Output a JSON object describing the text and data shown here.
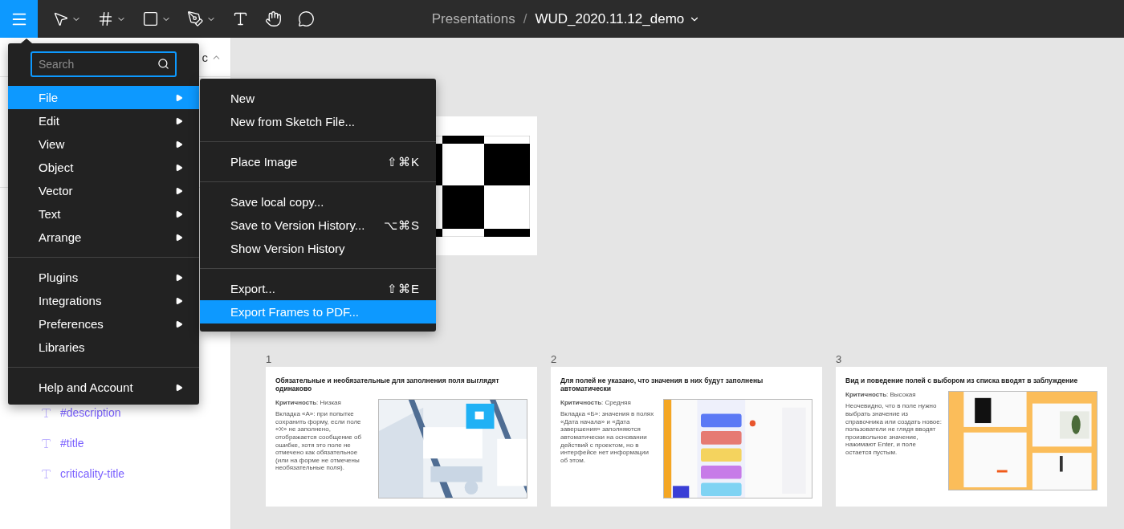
{
  "toolbar": {
    "tools": [
      {
        "kind": "move",
        "dropdown": true
      },
      {
        "kind": "frame",
        "dropdown": true
      },
      {
        "kind": "shape",
        "dropdown": true
      },
      {
        "kind": "pen",
        "dropdown": true
      },
      {
        "kind": "text",
        "dropdown": false
      },
      {
        "kind": "hand",
        "dropdown": false
      },
      {
        "kind": "comment",
        "dropdown": false
      }
    ],
    "menu_open": true
  },
  "breadcrumb": {
    "project": "Presentations",
    "separator": "/",
    "file": "WUD_2020.11.12_demo"
  },
  "sidebar": {
    "section_fragment": "c",
    "section_expanded": true,
    "layers": [
      {
        "name": "#description"
      },
      {
        "name": "#title"
      },
      {
        "name": "criticality-title"
      }
    ]
  },
  "main_menu": {
    "search_placeholder": "Search",
    "groups": [
      [
        {
          "label": "File",
          "submenu": true,
          "selected": true
        },
        {
          "label": "Edit",
          "submenu": true,
          "selected": false
        },
        {
          "label": "View",
          "submenu": true,
          "selected": false
        },
        {
          "label": "Object",
          "submenu": true,
          "selected": false
        },
        {
          "label": "Vector",
          "submenu": true,
          "selected": false
        },
        {
          "label": "Text",
          "submenu": true,
          "selected": false
        },
        {
          "label": "Arrange",
          "submenu": true,
          "selected": false
        }
      ],
      [
        {
          "label": "Plugins",
          "submenu": true,
          "selected": false
        },
        {
          "label": "Integrations",
          "submenu": true,
          "selected": false
        },
        {
          "label": "Preferences",
          "submenu": true,
          "selected": false
        },
        {
          "label": "Libraries",
          "submenu": false,
          "selected": false
        }
      ],
      [
        {
          "label": "Help and Account",
          "submenu": true,
          "selected": false
        }
      ]
    ]
  },
  "file_submenu": {
    "groups": [
      [
        {
          "label": "New",
          "selected": false
        },
        {
          "label": "New from Sketch File...",
          "selected": false
        }
      ],
      [
        {
          "label": "Place Image",
          "shortcut": "⇧⌘K",
          "selected": false
        }
      ],
      [
        {
          "label": "Save local copy...",
          "selected": false
        },
        {
          "label": "Save to Version History...",
          "shortcut": "⌥⌘S",
          "selected": false
        },
        {
          "label": "Show Version History",
          "selected": false
        }
      ],
      [
        {
          "label": "Export...",
          "shortcut": "⇧⌘E",
          "selected": false
        },
        {
          "label": "Export Frames to PDF...",
          "selected": true
        }
      ]
    ]
  },
  "canvas": {
    "frames": [
      {
        "number": "1",
        "title": "Обязательные и необязательные для заполнения поля выглядят одинаково",
        "criticality": "**Критичность**: Низкая",
        "description": "Вкладка «А»: при попытке сохранить форму, если поле «Х» не заполнено, отображается сообщение об ошибке, хотя это поле не отмечено как обязательное (или на форме не отмечены необязательные поля).",
        "kind": "picture"
      },
      {
        "number": "2",
        "title": "Для полей не указано, что значения в них будут заполнены автоматически",
        "criticality": "**Критичность**: Средняя",
        "description": "Вкладка «Б»: значения в полях «Дата начала» и «Дата завершения» заполняются автоматически на основании действий с проектом, но в интерфейсе нет информации об этом.",
        "kind": "picture"
      },
      {
        "number": "3",
        "title": "Вид и поведение полей с выбором из списка вводят в заблуждение",
        "criticality": "**Критичность**: Высокая",
        "description": "Неочевидно, что в поле нужно выбрать значение из справочника или создать новое: пользователи не глядя вводят произвольное значение, нажимают Enter, и поле остается пустым.",
        "kind": "picture"
      }
    ]
  }
}
